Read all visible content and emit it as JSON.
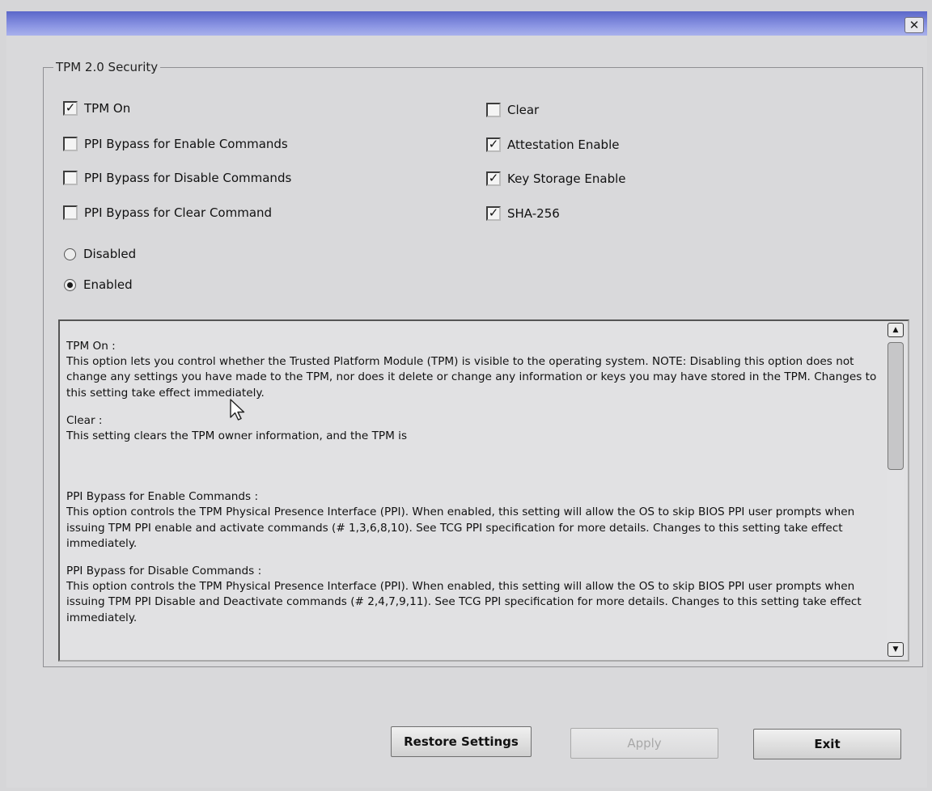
{
  "window": {
    "close_glyph": "✕"
  },
  "group": {
    "title": "TPM 2.0 Security"
  },
  "left_options": [
    {
      "label": "TPM On",
      "checked": true
    },
    {
      "label": "PPI Bypass for Enable Commands",
      "checked": false
    },
    {
      "label": "PPI Bypass for Disable Commands",
      "checked": false
    },
    {
      "label": "PPI Bypass for Clear Command",
      "checked": false
    }
  ],
  "right_options": [
    {
      "label": "Clear",
      "checked": false
    },
    {
      "label": "Attestation Enable",
      "checked": true
    },
    {
      "label": "Key Storage Enable",
      "checked": true
    },
    {
      "label": "SHA-256",
      "checked": true
    }
  ],
  "radios": [
    {
      "label": "Disabled",
      "selected": false
    },
    {
      "label": "Enabled",
      "selected": true
    }
  ],
  "help": {
    "sections": [
      {
        "title": "TPM On :",
        "text": "This option lets you control whether the Trusted Platform Module (TPM) is visible to the operating system. NOTE: Disabling this option does not change any settings you have made to the TPM, nor does it delete or change any information or keys you may have stored in the TPM.  Changes to this setting take effect immediately."
      },
      {
        "title": "Clear :",
        "text": "This setting clears the TPM owner information, and the TPM is"
      },
      {
        "title": "PPI Bypass for Enable Commands :",
        "text": "This option controls the TPM Physical Presence Interface (PPI). When enabled, this setting will allow the OS to skip BIOS PPI user prompts when issuing TPM PPI enable and activate commands (# 1,3,6,8,10).  See TCG PPI specification for more details. Changes to this setting take effect immediately."
      },
      {
        "title": "PPI Bypass for Disable Commands :",
        "text": "This option controls the TPM Physical Presence Interface (PPI). When enabled, this setting will allow the OS to skip BIOS PPI user prompts when issuing TPM PPI Disable and Deactivate commands (# 2,4,7,9,11).  See TCG PPI specification for more details.  Changes to this setting take effect immediately."
      }
    ],
    "scroll_position": 0.0
  },
  "scrollbar": {
    "up_glyph": "▲",
    "down_glyph": "▼"
  },
  "buttons": {
    "restore": "Restore Settings",
    "apply": "Apply",
    "exit": "Exit"
  },
  "icons": {
    "check": "✓",
    "cursor": "mouse-pointer-icon"
  }
}
